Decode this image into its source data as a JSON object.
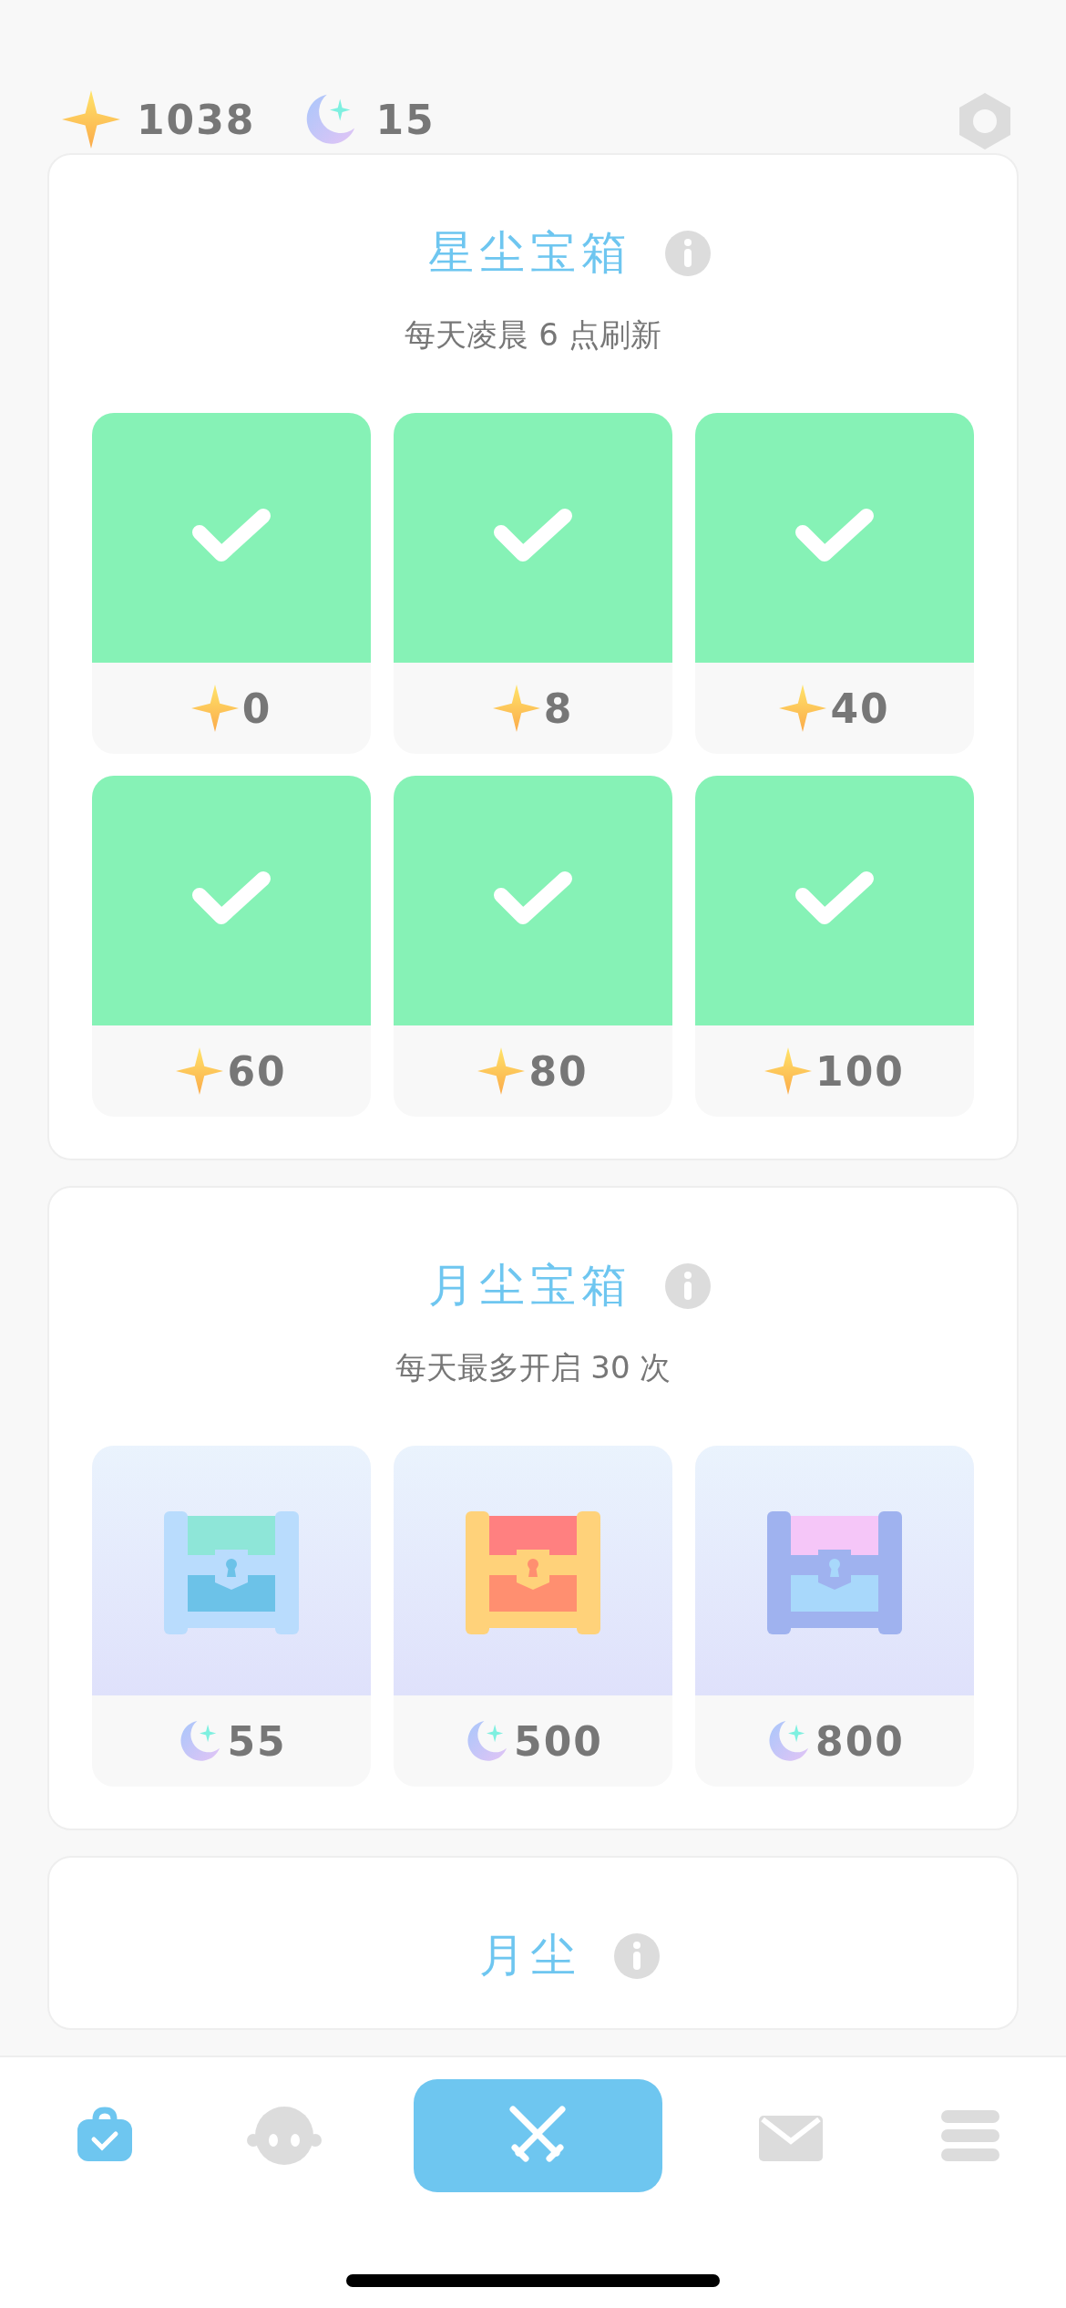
{
  "currencies": [
    {
      "kind": "star",
      "amount": "1038"
    },
    {
      "kind": "moon",
      "amount": "15"
    }
  ],
  "sections": [
    {
      "title": "星尘宝箱",
      "subtitle": "每天凌晨 6 点刷新",
      "kind": "star",
      "chests": [
        {
          "kind": "claimed",
          "cost": "0"
        },
        {
          "kind": "claimed",
          "cost": "8"
        },
        {
          "kind": "claimed",
          "cost": "40"
        },
        {
          "kind": "claimed",
          "cost": "60"
        },
        {
          "kind": "claimed",
          "cost": "80"
        },
        {
          "kind": "claimed",
          "cost": "100"
        }
      ]
    },
    {
      "title": "月尘宝箱",
      "subtitle": "每天最多开启 30 次",
      "kind": "moon",
      "chests": [
        {
          "kind": "small",
          "cost": "55"
        },
        {
          "kind": "medium",
          "cost": "500"
        },
        {
          "kind": "large",
          "cost": "800"
        }
      ]
    },
    {
      "title": "月尘"
    }
  ],
  "nav": [
    {
      "kind": "bag",
      "selected": false
    },
    {
      "kind": "face",
      "selected": false
    },
    {
      "kind": "swords",
      "selected": true
    },
    {
      "kind": "mail",
      "selected": false
    },
    {
      "kind": "menu",
      "selected": false
    }
  ]
}
